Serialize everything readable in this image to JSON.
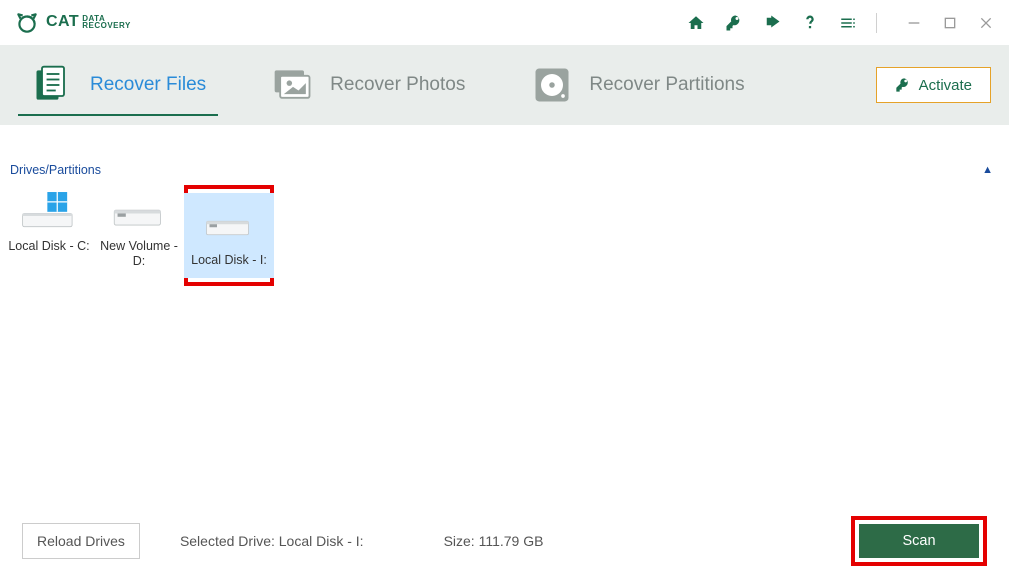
{
  "brand": {
    "name": "CAT",
    "sub1": "DATA",
    "sub2": "RECOVERY"
  },
  "title_icons": {
    "home": "home-icon",
    "key": "key-icon",
    "share": "share-icon",
    "help": "help-icon",
    "menu": "menu-icon"
  },
  "tabs": [
    {
      "id": "recover-files",
      "label": "Recover Files",
      "active": true
    },
    {
      "id": "recover-photos",
      "label": "Recover Photos",
      "active": false
    },
    {
      "id": "recover-partitions",
      "label": "Recover Partitions",
      "active": false
    }
  ],
  "activate_label": "Activate",
  "section_label": "Drives/Partitions",
  "drives": [
    {
      "label": "Local Disk - C:",
      "type": "windows",
      "selected": false
    },
    {
      "label": "New Volume - D:",
      "type": "disk",
      "selected": false
    },
    {
      "label": "Local Disk - I:",
      "type": "disk",
      "selected": true
    }
  ],
  "reload_label": "Reload Drives",
  "selected_drive_label": "Selected Drive: Local Disk - I:",
  "size_label": "Size: 111.79 GB",
  "scan_label": "Scan",
  "colors": {
    "accent": "#1b6e4e",
    "highlight_border": "#e40000",
    "tab_active_text": "#2a8bd8"
  }
}
